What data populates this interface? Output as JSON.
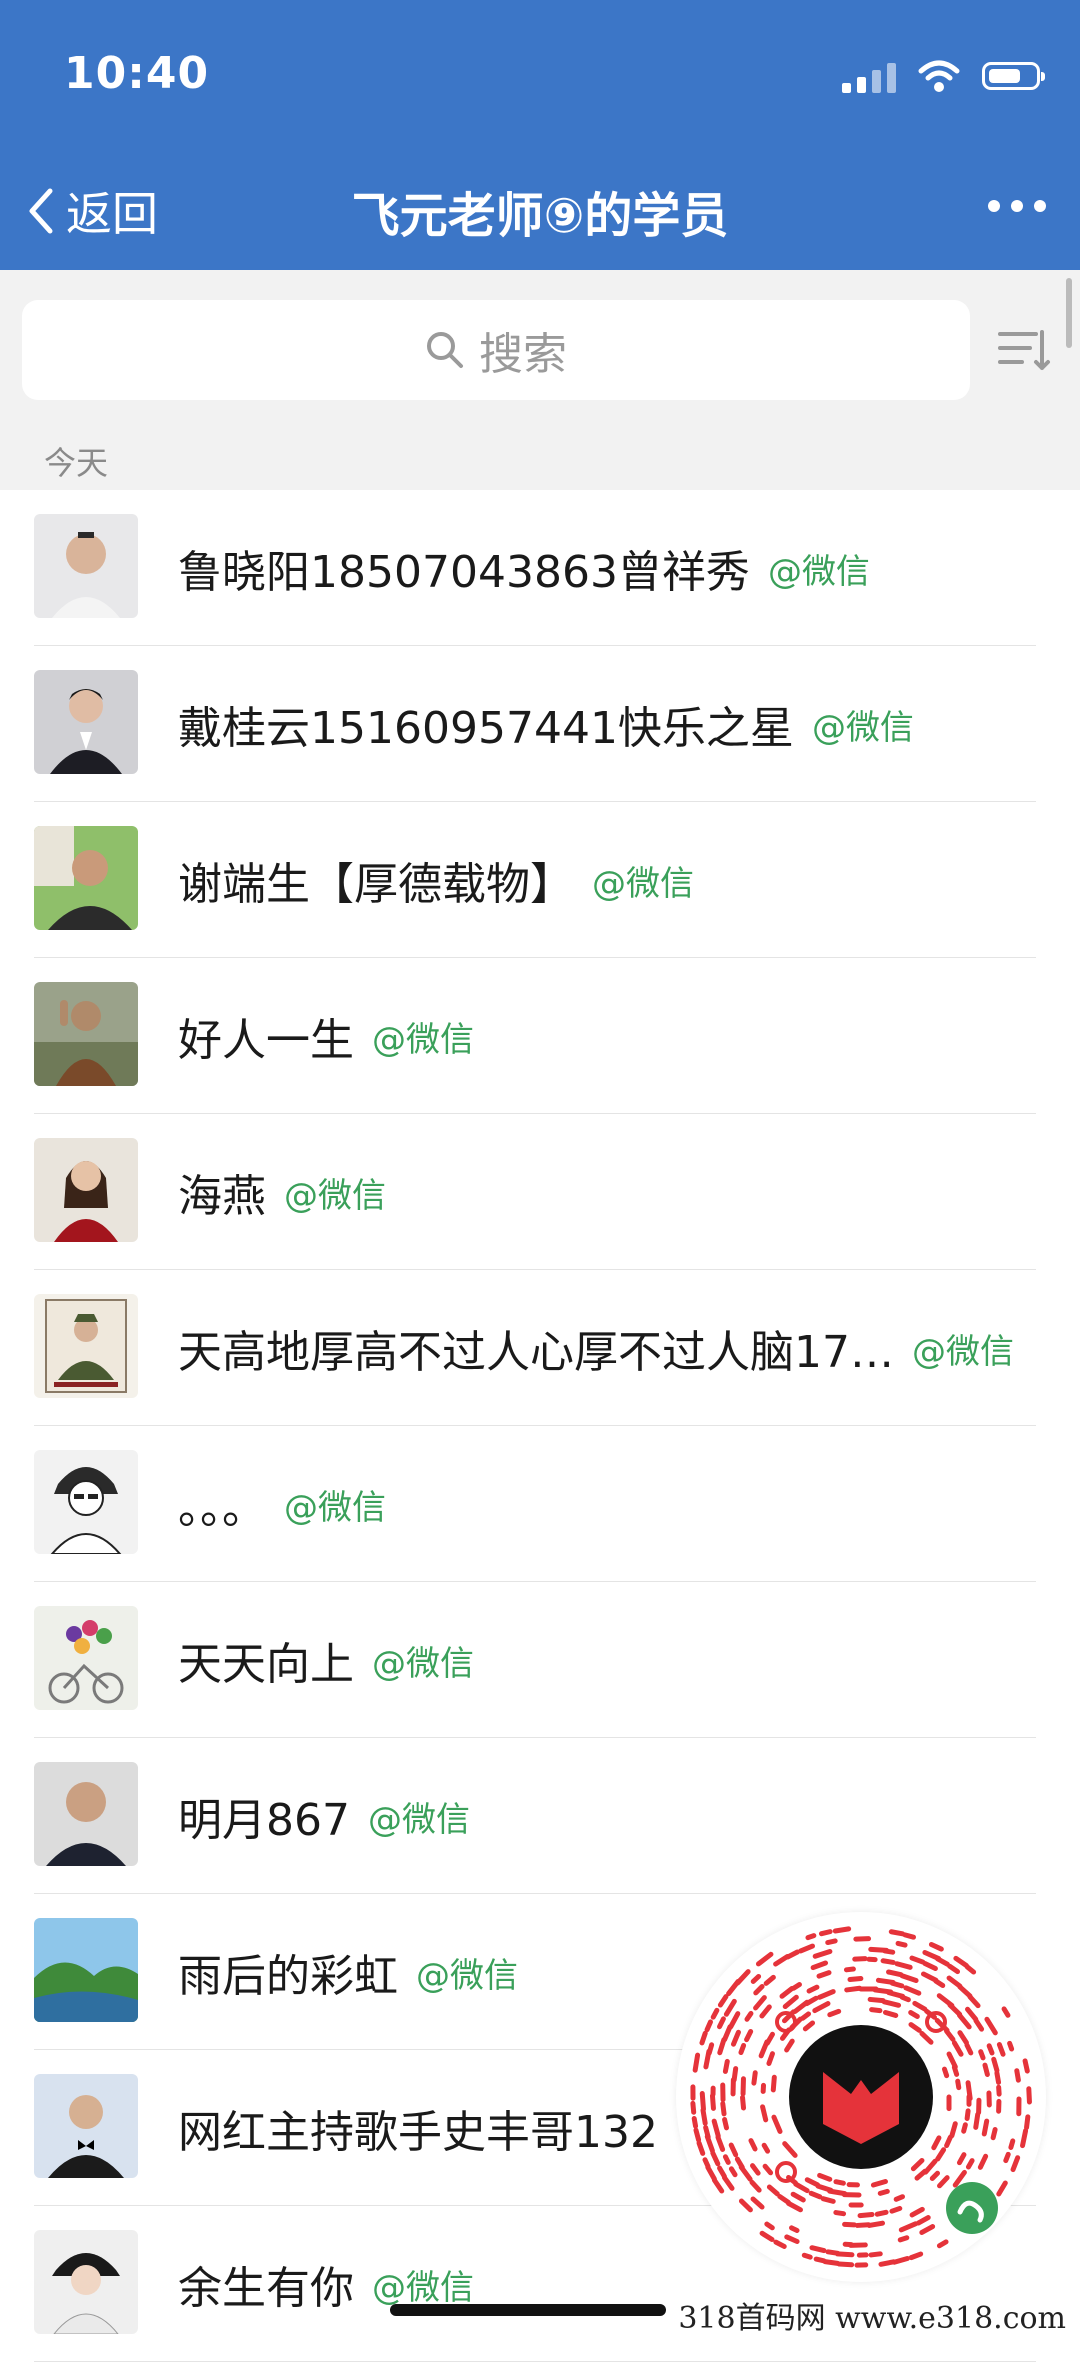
{
  "status": {
    "time": "10:40"
  },
  "nav": {
    "back_label": "返回",
    "title": "飞元老师⑨的学员"
  },
  "search": {
    "placeholder": "搜索"
  },
  "section_label": "今天",
  "contacts": [
    {
      "name": "鲁晓阳18507043863曾祥秀",
      "source": "@微信",
      "avatar": "man-white-shirt"
    },
    {
      "name": "戴桂云15160957441快乐之星",
      "source": "@微信",
      "avatar": "woman-suit"
    },
    {
      "name": "谢端生【厚德载物】",
      "source": "@微信",
      "avatar": "man-outdoor"
    },
    {
      "name": "好人一生",
      "source": "@微信",
      "avatar": "woman-waving"
    },
    {
      "name": "海燕",
      "source": "@微信",
      "avatar": "woman-red-dress"
    },
    {
      "name": "天高地厚高不过人心厚不过人脑17…",
      "source": "@微信",
      "avatar": "soldier-portrait"
    },
    {
      "name": "。。。",
      "source": "@微信",
      "avatar": "cartoon-boy"
    },
    {
      "name": "天天向上",
      "source": "@微信",
      "avatar": "flower-bicycle"
    },
    {
      "name": "明月867",
      "source": "@微信",
      "avatar": "bald-man"
    },
    {
      "name": "雨后的彩虹",
      "source": "@微信",
      "avatar": "green-mountains"
    },
    {
      "name": "网红主持歌手史丰哥132",
      "source": "",
      "avatar": "man-bowtie"
    },
    {
      "name": "余生有你",
      "source": "@微信",
      "avatar": "woman-hat"
    }
  ],
  "watermark": "318首码网  www.e318.com",
  "colors": {
    "header": "#3c76c7",
    "source_green": "#3aa05a",
    "qr_red": "#e5333a"
  }
}
